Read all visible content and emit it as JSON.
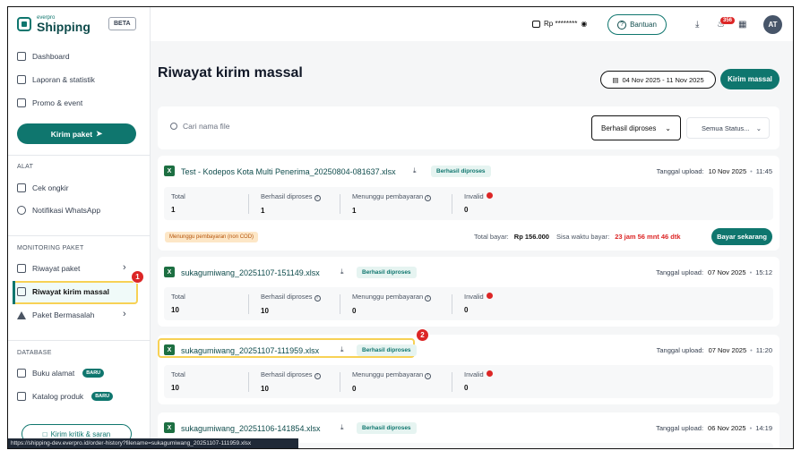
{
  "brand": {
    "sub": "everpro",
    "name": "Shipping",
    "beta": "BETA"
  },
  "sidebar": {
    "items": [
      {
        "label": "Dashboard"
      },
      {
        "label": "Laporan & statistik"
      },
      {
        "label": "Promo & event"
      }
    ],
    "kirim_paket": "Kirim paket",
    "section_alat": "ALAT",
    "alat_items": [
      {
        "label": "Cek ongkir"
      },
      {
        "label": "Notifikasi WhatsApp"
      }
    ],
    "section_monitoring": "MONITORING PAKET",
    "monitoring_items": [
      {
        "label": "Riwayat paket"
      },
      {
        "label": "Riwayat kirim massal"
      },
      {
        "label": "Paket Bermasalah"
      }
    ],
    "section_database": "DATABASE",
    "database_items": [
      {
        "label": "Buku alamat",
        "badge": "BARU"
      },
      {
        "label": "Katalog produk",
        "badge": "BARU"
      }
    ],
    "kritik": "Kirim kritik & saran"
  },
  "annotations": {
    "one": "1",
    "two": "2"
  },
  "topbar": {
    "balance": "Rp ********",
    "bantuan": "Bantuan",
    "notif_count": "356",
    "avatar": "AT"
  },
  "page": {
    "title": "Riwayat kirim massal",
    "date_range": "04 Nov 2025 - 11 Nov 2025",
    "kirim_massal": "Kirim massal",
    "search_placeholder": "Cari nama file",
    "filter1": "Berhasil diproses",
    "filter2": "Semua Status..."
  },
  "labels": {
    "upload": "Tanggal upload:",
    "total": "Total",
    "success": "Berhasil diproses",
    "waiting": "Menunggu pembayaran",
    "invalid": "Invalid",
    "pending_tag": "Menunggu pembayaran (non COD)",
    "total_bayar": "Total bayar:",
    "sisa": "Sisa waktu bayar:",
    "bayar": "Bayar sekarang"
  },
  "files": [
    {
      "name": "Test - Kodepos Kota Multi Penerima_20250804-081637.xlsx",
      "status": "Berhasil diproses",
      "date": "10 Nov 2025",
      "time": "11:45",
      "total": "1",
      "success": "1",
      "waiting": "1",
      "invalid": "0",
      "amount": "Rp 156.000",
      "countdown": "23 jam 56 mnt 46 dtk"
    },
    {
      "name": "sukagumiwang_20251107-151149.xlsx",
      "status": "Berhasil diproses",
      "date": "07 Nov 2025",
      "time": "15:12",
      "total": "10",
      "success": "10",
      "waiting": "0",
      "invalid": "0"
    },
    {
      "name": "sukagumiwang_20251107-111959.xlsx",
      "status": "Berhasil diproses",
      "date": "07 Nov 2025",
      "time": "11:20",
      "total": "10",
      "success": "10",
      "waiting": "0",
      "invalid": "0"
    },
    {
      "name": "sukagumiwang_20251106-141854.xlsx",
      "status": "Berhasil diproses",
      "date": "06 Nov 2025",
      "time": "14:19"
    }
  ],
  "statusbar": "https://shipping-dev.everpro.id/order-history?filename=sukagumiwang_20251107-111959.xlsx",
  "colors": {
    "primary": "#0f766e",
    "highlight": "#f7d155",
    "danger": "#dc2626"
  }
}
